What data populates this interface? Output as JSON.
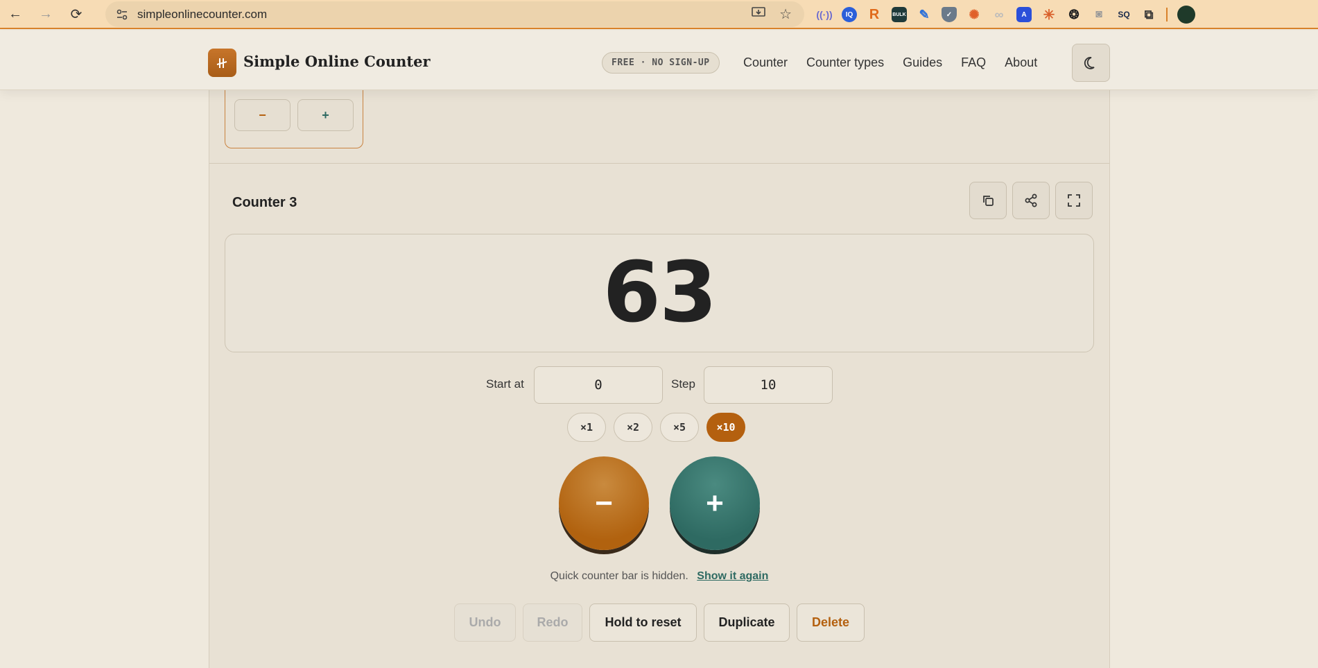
{
  "browser": {
    "url": "simpleonlinecounter.com"
  },
  "header": {
    "brand": "Simple Online Counter",
    "badge": "FREE · NO SIGN-UP",
    "nav": [
      "Counter",
      "Counter types",
      "Guides",
      "FAQ",
      "About"
    ]
  },
  "prev_counter": {
    "minus_label": "−",
    "plus_label": "+"
  },
  "counter": {
    "title": "Counter 3",
    "value": "63",
    "start_label": "Start at",
    "start_value": "0",
    "step_label": "Step",
    "step_value": "10",
    "multipliers": [
      "×1",
      "×2",
      "×5",
      "×10"
    ],
    "active_multiplier": "×10",
    "minus_label": "−",
    "plus_label": "+",
    "quick_bar_text": "Quick counter bar is hidden.",
    "quick_bar_link": "Show it again",
    "actions": {
      "undo": "Undo",
      "redo": "Redo",
      "reset": "Hold to reset",
      "duplicate": "Duplicate",
      "delete": "Delete"
    }
  },
  "colors": {
    "accent": "#b4600f",
    "teal": "#2e6a62",
    "page_bg": "#efe9dd"
  }
}
